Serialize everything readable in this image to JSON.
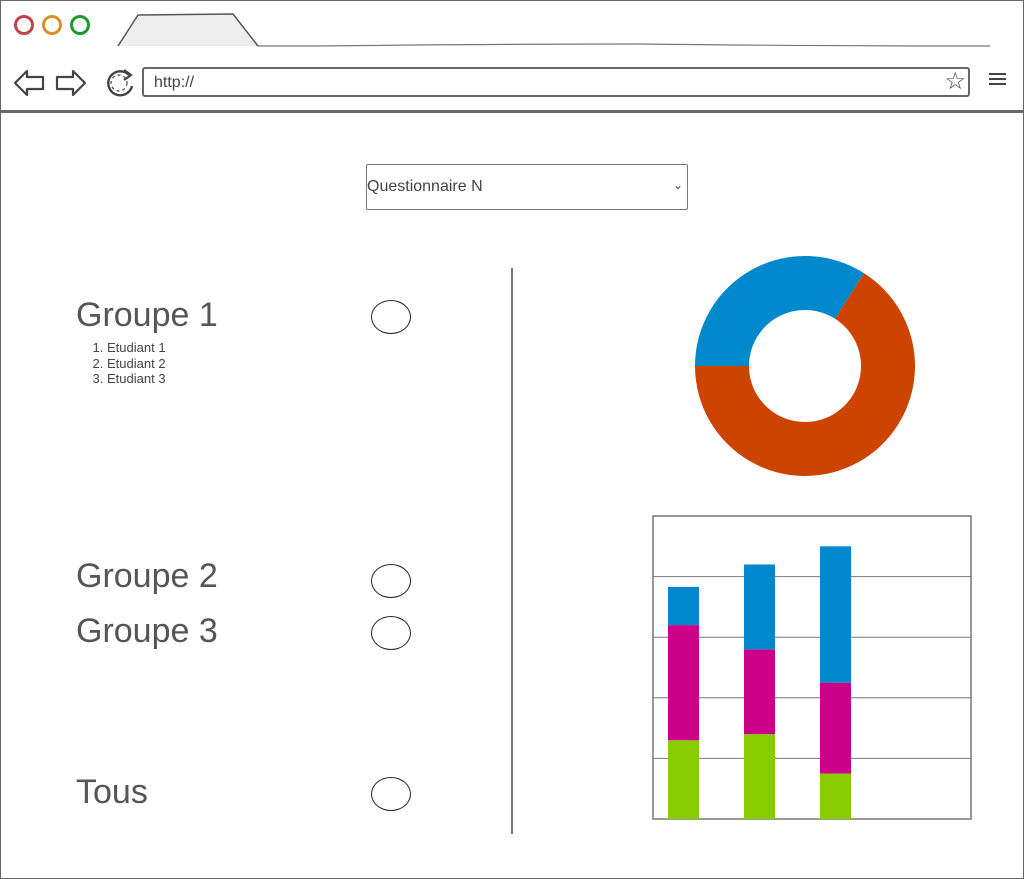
{
  "browser": {
    "url": "http://",
    "icons": [
      "back-arrow-icon",
      "forward-arrow-icon",
      "reload-icon",
      "star-icon",
      "hamburger-menu-icon"
    ],
    "dot_colors": [
      "#c0414a",
      "#d9902a",
      "#1a9a2a"
    ]
  },
  "questionnaire_select": {
    "value": "Questionnaire N"
  },
  "groups": [
    {
      "title": "Groupe 1",
      "students": [
        "Etudiant 1",
        "Etudiant 2",
        "Etudiant 3"
      ]
    },
    {
      "title": "Groupe 2"
    },
    {
      "title": "Groupe 3"
    },
    {
      "title": "Tous"
    }
  ],
  "chart_data": [
    {
      "type": "pie",
      "style": "donut",
      "slices": [
        {
          "value": 0.34,
          "color": "#0088cc"
        },
        {
          "value": 0.66,
          "color": "#cc4400"
        }
      ]
    },
    {
      "type": "bar",
      "stacked": true,
      "ylim": [
        0,
        5
      ],
      "grid": true,
      "categories": [
        "",
        "",
        ""
      ],
      "series": [
        {
          "color": "#88cc00",
          "values": [
            1.3,
            1.4,
            0.75
          ]
        },
        {
          "color": "#cc0088",
          "values": [
            1.9,
            1.4,
            1.5
          ]
        },
        {
          "color": "#0088cc",
          "values": [
            0.63,
            1.4,
            2.25
          ]
        }
      ]
    }
  ]
}
